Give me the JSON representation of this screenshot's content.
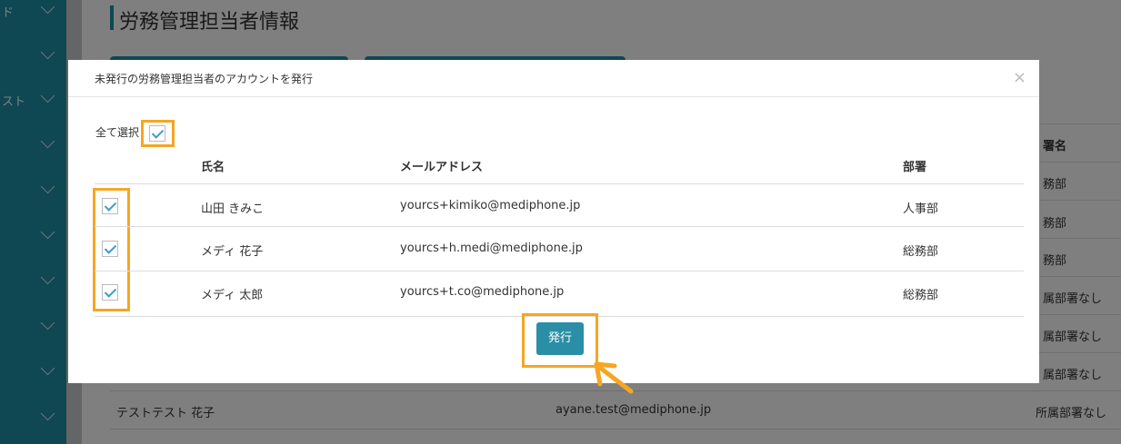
{
  "page": {
    "title": "労務管理担当者情報"
  },
  "sidebar": {
    "items": [
      {
        "label": "ド"
      },
      {
        "label": ""
      },
      {
        "label": "スト"
      },
      {
        "label": ""
      },
      {
        "label": ""
      },
      {
        "label": ""
      },
      {
        "label": ""
      },
      {
        "label": ""
      },
      {
        "label": ""
      }
    ]
  },
  "background_table": {
    "column_header_partial": "署名",
    "rows": [
      {
        "dept": "務部"
      },
      {
        "dept": "務部"
      },
      {
        "dept": "務部"
      },
      {
        "dept": "属部署なし"
      },
      {
        "dept": "属部署なし"
      },
      {
        "dept": "属部署なし"
      },
      {
        "name": "テストテスト 花子",
        "email": "ayane.test@mediphone.jp",
        "dept": "所属部署なし"
      }
    ]
  },
  "modal": {
    "title": "未発行の労務管理担当者のアカウントを発行",
    "close_symbol": "×",
    "select_all_label": "全て選択",
    "columns": [
      "氏名",
      "メールアドレス",
      "部署"
    ],
    "rows": [
      {
        "name": "山田 きみこ",
        "email": "yourcs+kimiko@mediphone.jp",
        "dept": "人事部",
        "checked": true
      },
      {
        "name": "メディ 花子",
        "email": "yourcs+h.medi@mediphone.jp",
        "dept": "総務部",
        "checked": true
      },
      {
        "name": "メディ 太郎",
        "email": "yourcs+t.co@mediphone.jp",
        "dept": "総務部",
        "checked": true
      }
    ],
    "issue_button_label": "発行"
  },
  "colors": {
    "accent": "#1f8fa6",
    "highlight": "#f5a623",
    "check": "#3a9ecf"
  }
}
